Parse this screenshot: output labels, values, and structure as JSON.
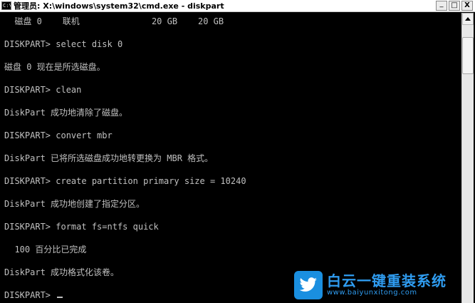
{
  "window": {
    "title": "管理员: X:\\windows\\system32\\cmd.exe - diskpart",
    "icon_label": "C:\\",
    "controls": {
      "minimize": "_",
      "restore": "□",
      "close": "X"
    }
  },
  "console": {
    "lines": [
      "  磁盘 0    联机              20 GB    20 GB",
      "",
      "DISKPART> select disk 0",
      "",
      "磁盘 0 现在是所选磁盘。",
      "",
      "DISKPART> clean",
      "",
      "DiskPart 成功地清除了磁盘。",
      "",
      "DISKPART> convert mbr",
      "",
      "DiskPart 已将所选磁盘成功地转更换为 MBR 格式。",
      "",
      "DISKPART> create partition primary size = 10240",
      "",
      "DiskPart 成功地创建了指定分区。",
      "",
      "DISKPART> format fs=ntfs quick",
      "",
      "  100 百分比已完成",
      "",
      "DiskPart 成功格式化该卷。",
      "",
      "DISKPART> "
    ],
    "colors": {
      "background": "#000000",
      "text": "#c0c0c0"
    }
  },
  "watermark": {
    "title": "白云一键重装系统",
    "url": "www.baiyunxitong.com",
    "color": "#2f9cf0",
    "logo_icon": "twitter-bird-icon"
  }
}
